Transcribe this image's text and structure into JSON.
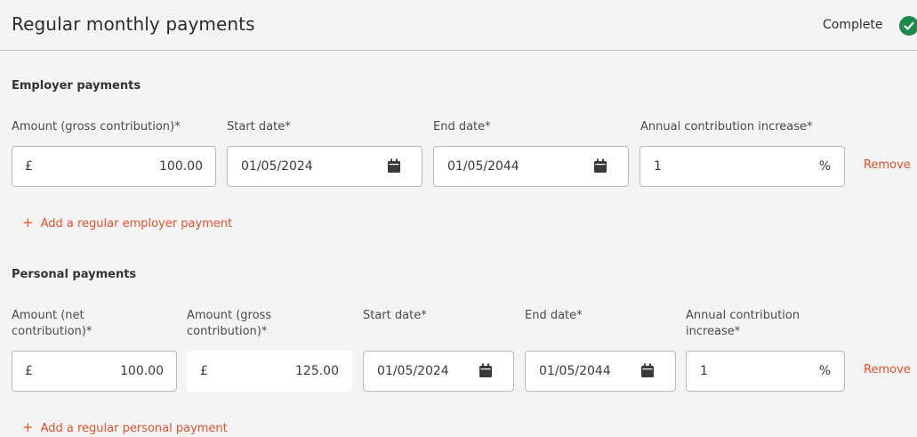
{
  "header": {
    "title": "Regular monthly payments",
    "status": "Complete"
  },
  "employer": {
    "section_title": "Employer payments",
    "labels": {
      "amount_gross": "Amount (gross contribution)*",
      "start_date": "Start date*",
      "end_date": "End date*",
      "annual_increase": "Annual contribution increase*"
    },
    "row": {
      "currency": "£",
      "amount_gross": "100.00",
      "start_date": "01/05/2024",
      "end_date": "01/05/2044",
      "annual_increase": "1",
      "percent": "%",
      "remove": "Remove"
    },
    "add_link": "+  Add a regular employer payment",
    "add_plus": "+",
    "add_label": "Add a regular employer payment"
  },
  "personal": {
    "section_title": "Personal payments",
    "labels": {
      "amount_net_1": "Amount (net",
      "amount_net_2": "contribution)*",
      "amount_gross_1": "Amount (gross",
      "amount_gross_2": "contribution)*",
      "start_date": "Start date*",
      "end_date": "End date*",
      "annual_increase_1": "Annual contribution",
      "annual_increase_2": "increase*"
    },
    "row": {
      "currency_net": "£",
      "amount_net": "100.00",
      "currency_gross": "£",
      "amount_gross": "125.00",
      "start_date": "01/05/2024",
      "end_date": "01/05/2044",
      "annual_increase": "1",
      "percent": "%",
      "remove": "Remove"
    },
    "add_plus": "+",
    "add_label": "Add a regular personal payment"
  },
  "colors": {
    "accent": "#e0522f",
    "complete_green": "#1f8a4c",
    "background": "#f4f4f4"
  },
  "icons": [
    "check-circle-icon",
    "calendar-icon",
    "plus-icon"
  ]
}
